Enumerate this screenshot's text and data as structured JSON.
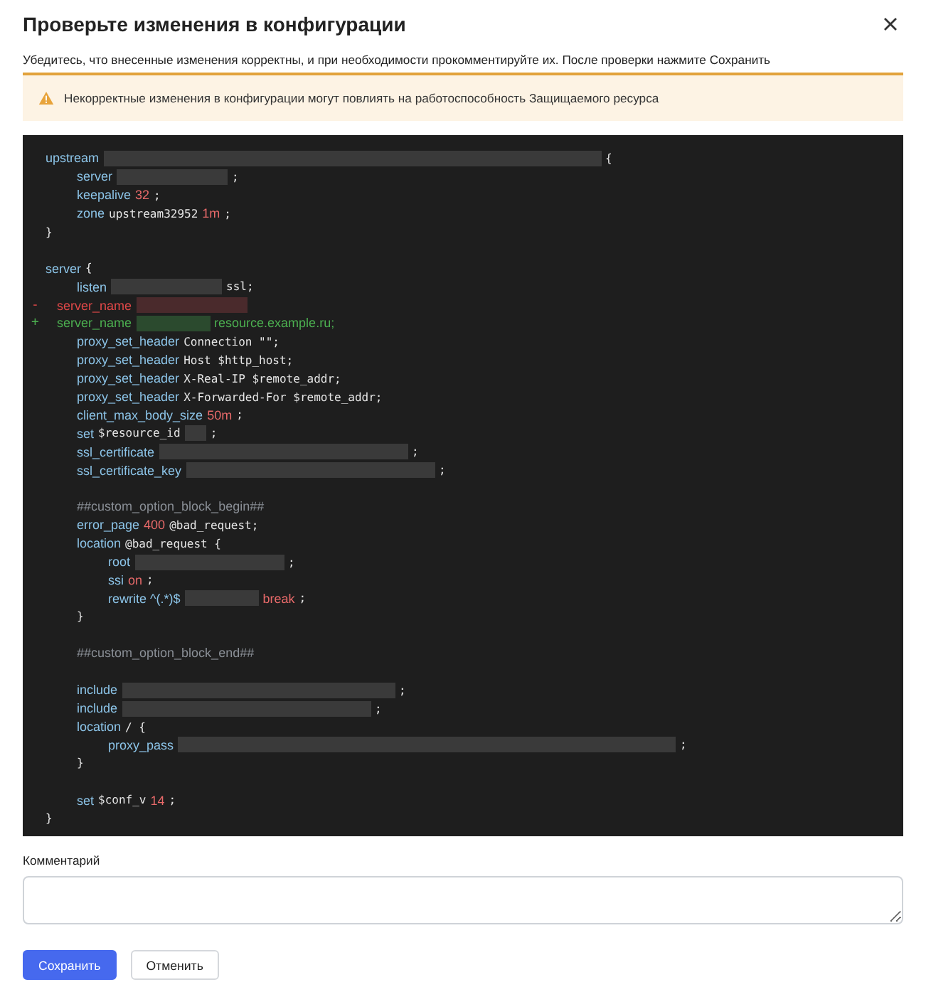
{
  "dialog": {
    "title": "Проверьте изменения в конфигурации",
    "description": "Убедитесь, что внесенные изменения корректны, и при необходимости прокомментируйте их. После проверки нажмите Сохранить"
  },
  "warning": {
    "text": "Некорректные изменения в конфигурации могут повлиять на работоспособность Защищаемого ресурса"
  },
  "config_diff": {
    "lines": [
      {
        "kind": "code",
        "tokens": [
          {
            "kind": "directive",
            "text": "upstream"
          },
          {
            "kind": "blurhuge"
          },
          {
            "kind": "plain",
            "text": "{"
          }
        ],
        "children": [
          {
            "kind": "code",
            "tokens": [
              {
                "kind": "directive",
                "text": "server"
              },
              {
                "kind": "blurm"
              },
              {
                "kind": "plain",
                "text": ";"
              }
            ]
          },
          {
            "kind": "code",
            "tokens": [
              {
                "kind": "directive",
                "text": "keepalive"
              },
              {
                "kind": "number",
                "text": "32"
              },
              {
                "kind": "plain",
                "text": ";"
              }
            ]
          },
          {
            "kind": "code",
            "tokens": [
              {
                "kind": "directive",
                "text": "zone"
              },
              {
                "kind": "plain",
                "text": "upstream32952"
              },
              {
                "kind": "number",
                "text": "1m"
              },
              {
                "kind": "plain",
                "text": ";"
              }
            ]
          }
        ]
      },
      {
        "kind": "code",
        "tokens": [
          {
            "kind": "plain",
            "text": "}"
          }
        ]
      },
      {
        "kind": "blank"
      },
      {
        "kind": "code",
        "tokens": [
          {
            "kind": "directive",
            "text": "server"
          },
          {
            "kind": "plain",
            "text": "{"
          }
        ],
        "children": [
          {
            "kind": "code",
            "tokens": [
              {
                "kind": "directive",
                "text": "listen"
              },
              {
                "kind": "blurm"
              },
              {
                "kind": "plain",
                "text": "ssl;"
              }
            ]
          },
          {
            "kind": "removed",
            "marker": "-",
            "tokens": [
              {
                "kind": "directive",
                "text": "server_name"
              },
              {
                "kind": "blurm"
              }
            ]
          },
          {
            "kind": "added",
            "marker": "+",
            "tokens": [
              {
                "kind": "directive",
                "text": "server_name"
              },
              {
                "kind": "blurs"
              },
              {
                "kind": "directive",
                "text": "resource.example.ru;"
              }
            ]
          },
          {
            "kind": "code",
            "tokens": [
              {
                "kind": "directive",
                "text": "proxy_set_header"
              },
              {
                "kind": "plain",
                "text": "Connection \"\";"
              }
            ]
          },
          {
            "kind": "code",
            "tokens": [
              {
                "kind": "directive",
                "text": "proxy_set_header"
              },
              {
                "kind": "plain",
                "text": "Host $http_host;"
              }
            ]
          },
          {
            "kind": "code",
            "tokens": [
              {
                "kind": "directive",
                "text": "proxy_set_header"
              },
              {
                "kind": "plain",
                "text": "X-Real-IP $remote_addr;"
              }
            ]
          },
          {
            "kind": "code",
            "tokens": [
              {
                "kind": "directive",
                "text": "proxy_set_header"
              },
              {
                "kind": "plain",
                "text": "X-Forwarded-For $remote_addr;"
              }
            ]
          },
          {
            "kind": "code",
            "tokens": [
              {
                "kind": "directive",
                "text": "client_max_body_size"
              },
              {
                "kind": "number",
                "text": "50m"
              },
              {
                "kind": "plain",
                "text": ";"
              }
            ]
          },
          {
            "kind": "code",
            "tokens": [
              {
                "kind": "directive",
                "text": "set"
              },
              {
                "kind": "plain",
                "text": "$resource_id"
              },
              {
                "kind": "blurxs"
              },
              {
                "kind": "plain",
                "text": ";"
              }
            ]
          },
          {
            "kind": "code",
            "tokens": [
              {
                "kind": "directive",
                "text": "ssl_certificate"
              },
              {
                "kind": "blurxl"
              },
              {
                "kind": "plain",
                "text": ";"
              }
            ]
          },
          {
            "kind": "code",
            "tokens": [
              {
                "kind": "directive",
                "text": "ssl_certificate_key"
              },
              {
                "kind": "blurxl"
              },
              {
                "kind": "plain",
                "text": ";"
              }
            ]
          },
          {
            "kind": "blank"
          },
          {
            "kind": "code",
            "tokens": [
              {
                "kind": "comment",
                "text": "##custom_option_block_begin##"
              }
            ]
          },
          {
            "kind": "code",
            "tokens": [
              {
                "kind": "directive",
                "text": "error_page"
              },
              {
                "kind": "number",
                "text": "400"
              },
              {
                "kind": "plain",
                "text": "@bad_request;"
              }
            ]
          },
          {
            "kind": "code",
            "tokens": [
              {
                "kind": "directive",
                "text": "location"
              },
              {
                "kind": "plain",
                "text": "@bad_request {"
              }
            ],
            "children": [
              {
                "kind": "code",
                "tokens": [
                  {
                    "kind": "directive",
                    "text": "root"
                  },
                  {
                    "kind": "blurl"
                  },
                  {
                    "kind": "plain",
                    "text": ";"
                  }
                ]
              },
              {
                "kind": "code",
                "tokens": [
                  {
                    "kind": "directive",
                    "text": "ssi"
                  },
                  {
                    "kind": "number",
                    "text": "on"
                  },
                  {
                    "kind": "plain",
                    "text": ";"
                  }
                ]
              },
              {
                "kind": "code",
                "tokens": [
                  {
                    "kind": "directive",
                    "text": "rewrite ^(.*)$"
                  },
                  {
                    "kind": "blurs"
                  },
                  {
                    "kind": "number",
                    "text": "break"
                  },
                  {
                    "kind": "plain",
                    "text": ";"
                  }
                ]
              }
            ]
          },
          {
            "kind": "code",
            "tokens": [
              {
                "kind": "plain",
                "text": "}"
              }
            ]
          },
          {
            "kind": "blank"
          },
          {
            "kind": "code",
            "tokens": [
              {
                "kind": "comment",
                "text": "##custom_option_block_end##"
              }
            ]
          },
          {
            "kind": "blank"
          },
          {
            "kind": "code",
            "tokens": [
              {
                "kind": "directive",
                "text": "include"
              },
              {
                "kind": "blurxxl"
              },
              {
                "kind": "plain",
                "text": ";"
              }
            ]
          },
          {
            "kind": "code",
            "tokens": [
              {
                "kind": "directive",
                "text": "include"
              },
              {
                "kind": "blurxl"
              },
              {
                "kind": "plain",
                "text": ";"
              }
            ]
          },
          {
            "kind": "code",
            "tokens": [
              {
                "kind": "directive",
                "text": "location"
              },
              {
                "kind": "plain",
                "text": "/ {"
              }
            ],
            "children": [
              {
                "kind": "code",
                "tokens": [
                  {
                    "kind": "directive",
                    "text": "proxy_pass"
                  },
                  {
                    "kind": "blurhuge"
                  },
                  {
                    "kind": "plain",
                    "text": ";"
                  }
                ]
              }
            ]
          },
          {
            "kind": "code",
            "tokens": [
              {
                "kind": "plain",
                "text": "}"
              }
            ]
          },
          {
            "kind": "blank"
          },
          {
            "kind": "code",
            "tokens": [
              {
                "kind": "directive",
                "text": "set"
              },
              {
                "kind": "plain",
                "text": "$conf_v"
              },
              {
                "kind": "number",
                "text": "14"
              },
              {
                "kind": "plain",
                "text": ";"
              }
            ]
          }
        ]
      },
      {
        "kind": "code",
        "tokens": [
          {
            "kind": "plain",
            "text": "}"
          }
        ]
      }
    ]
  },
  "comment_field": {
    "label": "Комментарий"
  },
  "buttons": [
    {
      "kind": "primary",
      "label": "Сохранить"
    },
    {
      "kind": "secondary",
      "label": "Отменить"
    }
  ]
}
